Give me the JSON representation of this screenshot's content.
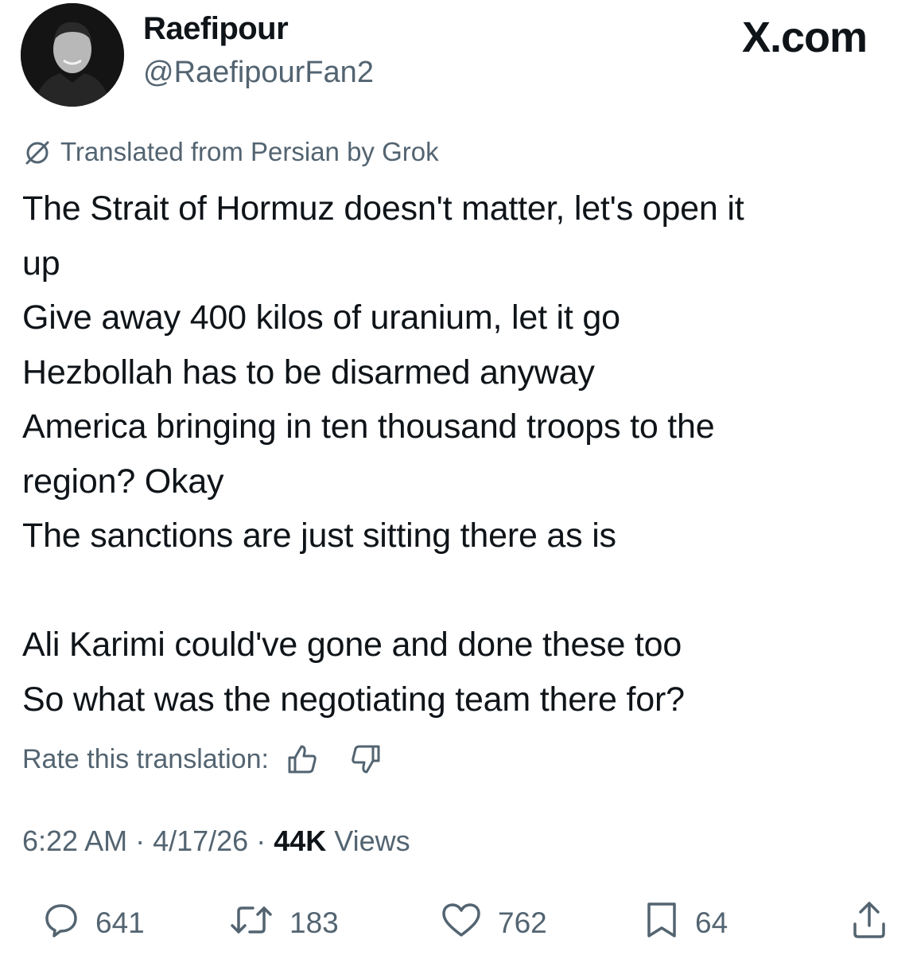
{
  "author": {
    "display_name": "Raefipour",
    "handle": "@RaefipourFan2"
  },
  "site_logo": "X.com",
  "translation_notice": "Translated from Persian by Grok",
  "tweet_lines": [
    "The Strait of Hormuz doesn't matter, let's open it",
    "up",
    "Give away 400 kilos of uranium, let it go",
    "Hezbollah has to be disarmed anyway",
    "America bringing in ten thousand troops to the",
    "region? Okay",
    "The sanctions are just sitting there as is",
    "",
    "Ali Karimi could've gone and done these too",
    "So what was the negotiating team there for?"
  ],
  "rate_label": "Rate this translation:",
  "meta": {
    "time": "6:22 AM",
    "separator": "·",
    "date": "4/17/26",
    "views_count": "44K",
    "views_label": "Views"
  },
  "actions": {
    "replies": "641",
    "reposts": "183",
    "likes": "762",
    "bookmarks": "64"
  },
  "icons": {
    "translate": "slashed-circle-icon",
    "thumbs_up": "thumbs-up-icon",
    "thumbs_down": "thumbs-down-icon",
    "reply": "reply-bubble-icon",
    "repost": "repost-arrows-icon",
    "like": "heart-icon",
    "bookmark": "bookmark-icon",
    "share": "share-upload-icon"
  },
  "colors": {
    "text_primary": "#0f1419",
    "text_secondary": "#536471",
    "background": "#ffffff"
  }
}
